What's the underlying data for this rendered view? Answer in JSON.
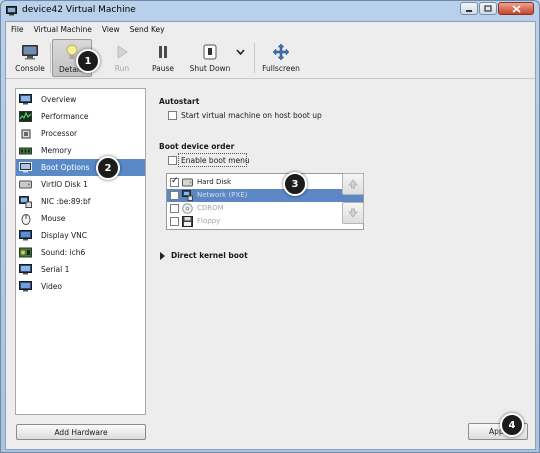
{
  "window": {
    "title": "device42 Virtual Machine"
  },
  "menubar": {
    "items": [
      "File",
      "Virtual Machine",
      "View",
      "Send Key"
    ]
  },
  "toolbar": {
    "console": "Console",
    "details": "Details",
    "run": "Run",
    "pause": "Pause",
    "shutdown": "Shut Down",
    "fullscreen": "Fullscreen"
  },
  "hardware": {
    "items": [
      "Overview",
      "Performance",
      "Processor",
      "Memory",
      "Boot Options",
      "VirtIO Disk 1",
      "NIC :be:89:bf",
      "Mouse",
      "Display VNC",
      "Sound: ich6",
      "Serial 1",
      "Video"
    ],
    "selected": "Boot Options",
    "add_button": "Add Hardware"
  },
  "autostart": {
    "heading": "Autostart",
    "option": "Start virtual machine on host boot up",
    "checked": false
  },
  "boot": {
    "heading": "Boot device order",
    "menu_option": "Enable boot menu",
    "menu_checked": false,
    "devices": [
      {
        "label": "Hard Disk",
        "checked": true,
        "enabled": true,
        "icon": "disk-icon"
      },
      {
        "label": "Network (PXE)",
        "checked": false,
        "enabled": true,
        "icon": "network-icon"
      },
      {
        "label": "CDROM",
        "checked": false,
        "enabled": false,
        "icon": "cdrom-icon"
      },
      {
        "label": "Floppy",
        "checked": false,
        "enabled": false,
        "icon": "floppy-icon"
      }
    ]
  },
  "kernel": {
    "heading": "Direct kernel boot"
  },
  "apply": {
    "label": "Apply"
  },
  "markers": [
    "1",
    "2",
    "3",
    "4"
  ],
  "colors": {
    "selection": "#5a89c8",
    "marker": "#1c1c1c"
  }
}
